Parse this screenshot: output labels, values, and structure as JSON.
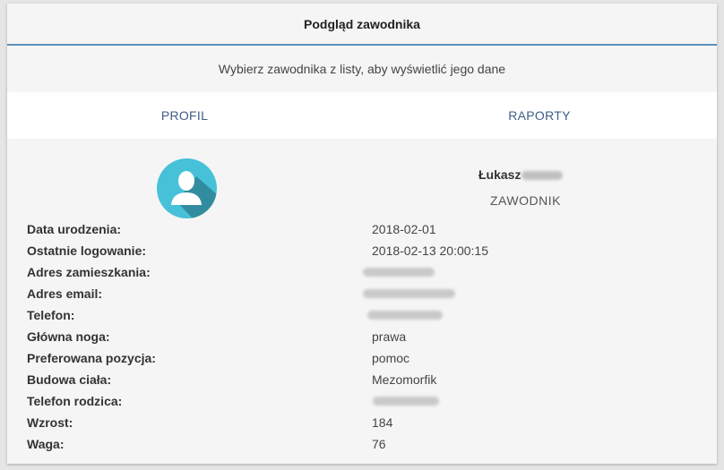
{
  "header": {
    "title": "Podgląd zawodnika"
  },
  "hint": "Wybierz zawodnika z listy, aby wyświetlić jego dane",
  "tabs": [
    {
      "label": "PROFIL"
    },
    {
      "label": "RAPORTY"
    }
  ],
  "profile": {
    "first_name": "Łukasz",
    "role": "ZAWODNIK",
    "fields": [
      {
        "label": "Data urodzenia:",
        "value": "2018-02-01"
      },
      {
        "label": "Ostatnie logowanie:",
        "value": "2018-02-13 20:00:15"
      },
      {
        "label": "Adres zamieszkania:",
        "value": ""
      },
      {
        "label": "Adres email:",
        "value": ""
      },
      {
        "label": "Telefon:",
        "value": ""
      },
      {
        "label": "Główna noga:",
        "value": "prawa"
      },
      {
        "label": "Preferowana pozycja:",
        "value": "pomoc"
      },
      {
        "label": "Budowa ciała:",
        "value": "Mezomorfik"
      },
      {
        "label": "Telefon rodzica:",
        "value": ""
      },
      {
        "label": "Wzrost:",
        "value": "184"
      },
      {
        "label": "Waga:",
        "value": "76"
      }
    ]
  },
  "colors": {
    "accent": "#5b8fb9",
    "tab_text": "#3f5d86",
    "avatar_bg": "#46c1d8"
  },
  "icons": {
    "avatar": "user-silhouette-icon"
  }
}
